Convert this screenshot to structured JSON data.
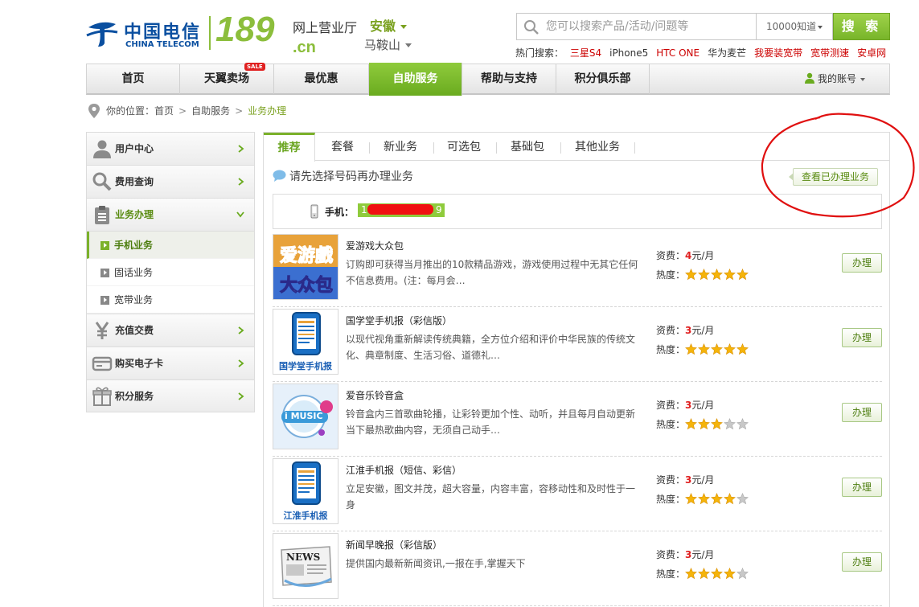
{
  "brand": {
    "name_cn": "中国电信",
    "name_en": "CHINA TELECOM",
    "logo_number": "189",
    "logo_suffix": ".cn",
    "site_title": "网上营业厅",
    "province": "安徽",
    "city": "马鞍山",
    "accent": "#8cbe3c"
  },
  "search": {
    "placeholder": "您可以搜索产品/活动/问题等",
    "scope": "10000知道",
    "button_label": "搜 索"
  },
  "hot_searches": {
    "label": "热门搜索：",
    "items": [
      {
        "text": "三星S4",
        "color": "#cc0000"
      },
      {
        "text": "iPhone5",
        "color": "#333333"
      },
      {
        "text": "HTC ONE",
        "color": "#cc0000"
      },
      {
        "text": "华为麦芒",
        "color": "#333333"
      },
      {
        "text": "我要装宽带",
        "color": "#cc0000"
      },
      {
        "text": "宽带测速",
        "color": "#cc0000"
      },
      {
        "text": "安卓网",
        "color": "#cc0000"
      }
    ]
  },
  "nav": {
    "items": [
      {
        "label": "首页"
      },
      {
        "label": "天翼卖场",
        "badge": "SALE"
      },
      {
        "label": "最优惠"
      },
      {
        "label": "自助服务",
        "active": true
      },
      {
        "label": "帮助与支持"
      },
      {
        "label": "积分俱乐部"
      }
    ],
    "account_label": "我的账号"
  },
  "breadcrumb": {
    "prefix": "你的位置：",
    "items": [
      "首页",
      "自助服务"
    ],
    "current": "业务办理"
  },
  "sidebar": {
    "items": [
      {
        "label": "用户中心",
        "icon": "user-icon"
      },
      {
        "label": "费用查询",
        "icon": "magnifier-icon"
      },
      {
        "label": "业务办理",
        "icon": "clipboard-icon",
        "open": true
      },
      {
        "label": "充值交费",
        "icon": "yen-icon"
      },
      {
        "label": "购买电子卡",
        "icon": "card-icon"
      },
      {
        "label": "积分服务",
        "icon": "gift-icon"
      }
    ],
    "sub_items": [
      {
        "label": "手机业务",
        "active": true
      },
      {
        "label": "固话业务"
      },
      {
        "label": "宽带业务"
      }
    ]
  },
  "tabs": [
    "推荐",
    "套餐",
    "新业务",
    "可选包",
    "基础包",
    "其他业务"
  ],
  "notice": "请先选择号码再办理业务",
  "view_done_label": "查看已办理业务",
  "phone": {
    "label": "手机：",
    "number_prefix": "1",
    "number_suffix": "9"
  },
  "product_labels": {
    "fee": "资费：",
    "heat": "热度：",
    "unit": "元/月",
    "apply": "办理"
  },
  "products": [
    {
      "name": "爱游戏大众包",
      "desc": "订购即可获得当月推出的10款精品游戏，游戏使用过程中无其它任何不信息费用。(注：每月会…",
      "price": "4",
      "stars": 5,
      "thumb_text": "爱游戏大众包",
      "thumb": "game-icon"
    },
    {
      "name": "国学堂手机报（彩信版）",
      "desc": "以现代视角重新解读传统典籍，全方位介绍和评价中华民族的传统文化、典章制度、生活习俗、道德礼…",
      "price": "3",
      "stars": 5,
      "thumb_text": "国学堂手机报",
      "thumb": "newspaper-phone-icon"
    },
    {
      "name": "爱音乐铃音盒",
      "desc": "铃音盒内三首歌曲轮播，让彩铃更加个性、动听，并且每月自动更新当下最热歌曲内容，无须自己动手…",
      "price": "3",
      "stars": 3,
      "thumb_text": "i MUSIC",
      "thumb": "music-icon"
    },
    {
      "name": "江淮手机报（短信、彩信）",
      "desc": "立足安徽，图文并茂，超大容量，内容丰富，容移动性和及时性于一身",
      "price": "3",
      "stars": 4,
      "thumb_text": "江淮手机报",
      "thumb": "newspaper-phone-icon"
    },
    {
      "name": "新闻早晚报（彩信版）",
      "desc": "提供国内最新新闻资讯,一报在手,掌握天下",
      "price": "3",
      "stars": 4,
      "thumb_text": "NEWS",
      "thumb": "news-icon"
    }
  ]
}
